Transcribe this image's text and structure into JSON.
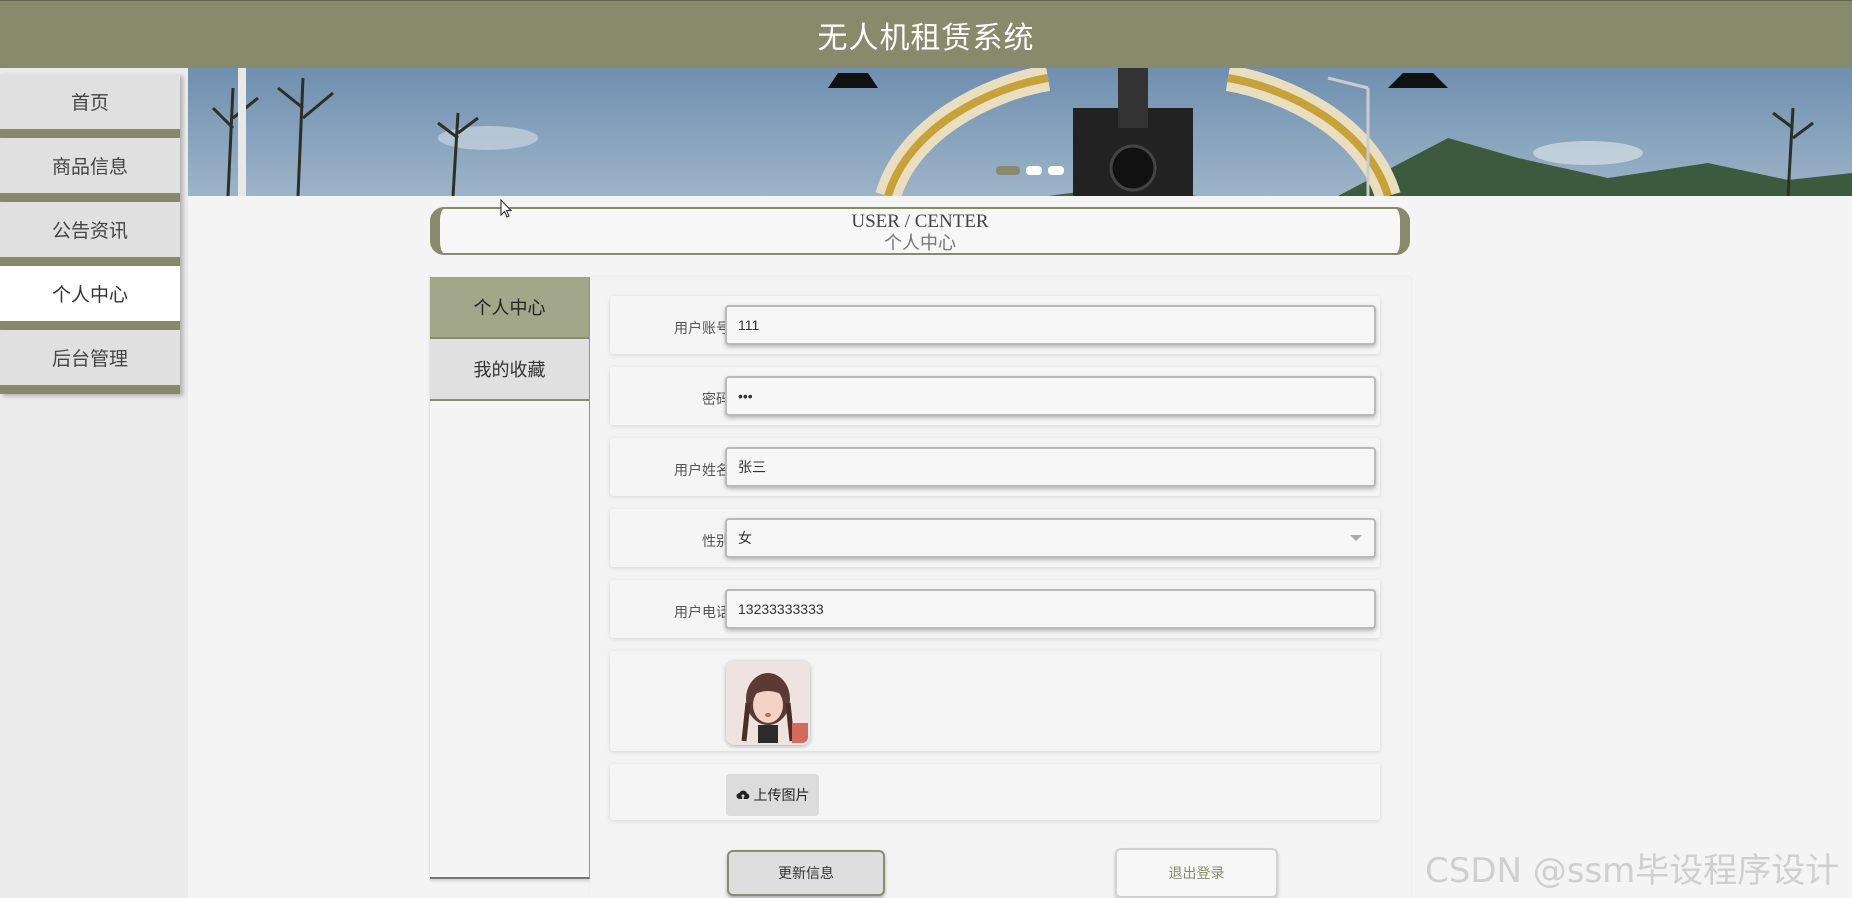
{
  "header": {
    "title": "无人机租赁系统"
  },
  "nav": {
    "items": [
      {
        "label": "首页"
      },
      {
        "label": "商品信息"
      },
      {
        "label": "公告资讯"
      },
      {
        "label": "个人中心"
      },
      {
        "label": "后台管理"
      }
    ],
    "active_index": 3
  },
  "banner": {
    "slide_count": 3,
    "active_slide": 1
  },
  "page_title": {
    "en": "USER / CENTER",
    "cn": "个人中心"
  },
  "side_tabs": {
    "items": [
      {
        "label": "个人中心"
      },
      {
        "label": "我的收藏"
      }
    ],
    "active_index": 0
  },
  "form": {
    "account": {
      "label": "用户账号",
      "value": "111"
    },
    "password": {
      "label": "密码",
      "value": "•••"
    },
    "name": {
      "label": "用户姓名",
      "value": "张三"
    },
    "gender": {
      "label": "性别",
      "value": "女"
    },
    "phone": {
      "label": "用户电话",
      "value": "13233333333"
    },
    "upload_label": "上传图片"
  },
  "actions": {
    "update": "更新信息",
    "logout": "退出登录"
  },
  "watermark": "CSDN @ssm毕设程序设计",
  "colors": {
    "accent": "#878b6c",
    "accent_light": "#a3a789",
    "background": "#f4f4f4"
  }
}
